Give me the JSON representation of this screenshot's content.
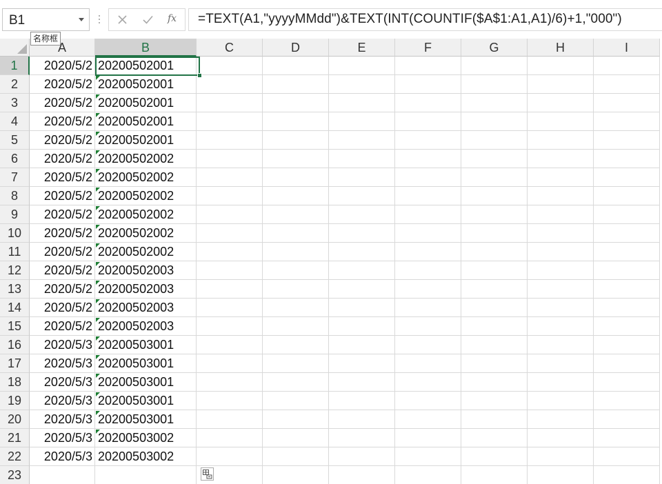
{
  "name_box": {
    "value": "B1",
    "tooltip": "名称框"
  },
  "formula_bar": {
    "cancel_icon": "close-icon",
    "enter_icon": "check-icon",
    "fx_label": "fx",
    "formula": "=TEXT(A1,\"yyyyMMdd\")&TEXT(INT(COUNTIF($A$1:A1,A1)/6)+1,\"000\")"
  },
  "columns": [
    "A",
    "B",
    "C",
    "D",
    "E",
    "F",
    "G",
    "H",
    "I"
  ],
  "active_column": "B",
  "active_row": "1",
  "active_cell": "B1",
  "rows": [
    {
      "row": "1",
      "a": "2020/5/2",
      "b": "20200502001"
    },
    {
      "row": "2",
      "a": "2020/5/2",
      "b": "20200502001"
    },
    {
      "row": "3",
      "a": "2020/5/2",
      "b": "20200502001"
    },
    {
      "row": "4",
      "a": "2020/5/2",
      "b": "20200502001"
    },
    {
      "row": "5",
      "a": "2020/5/2",
      "b": "20200502001"
    },
    {
      "row": "6",
      "a": "2020/5/2",
      "b": "20200502002"
    },
    {
      "row": "7",
      "a": "2020/5/2",
      "b": "20200502002"
    },
    {
      "row": "8",
      "a": "2020/5/2",
      "b": "20200502002"
    },
    {
      "row": "9",
      "a": "2020/5/2",
      "b": "20200502002"
    },
    {
      "row": "10",
      "a": "2020/5/2",
      "b": "20200502002"
    },
    {
      "row": "11",
      "a": "2020/5/2",
      "b": "20200502002"
    },
    {
      "row": "12",
      "a": "2020/5/2",
      "b": "20200502003"
    },
    {
      "row": "13",
      "a": "2020/5/2",
      "b": "20200502003"
    },
    {
      "row": "14",
      "a": "2020/5/2",
      "b": "20200502003"
    },
    {
      "row": "15",
      "a": "2020/5/2",
      "b": "20200502003"
    },
    {
      "row": "16",
      "a": "2020/5/3",
      "b": "20200503001"
    },
    {
      "row": "17",
      "a": "2020/5/3",
      "b": "20200503001"
    },
    {
      "row": "18",
      "a": "2020/5/3",
      "b": "20200503001"
    },
    {
      "row": "19",
      "a": "2020/5/3",
      "b": "20200503001"
    },
    {
      "row": "20",
      "a": "2020/5/3",
      "b": "20200503001"
    },
    {
      "row": "21",
      "a": "2020/5/3",
      "b": "20200503002"
    },
    {
      "row": "22",
      "a": "2020/5/3",
      "b": "20200503002"
    },
    {
      "row": "23",
      "a": "",
      "b": ""
    }
  ],
  "error_indicator_rows": [
    "2",
    "3",
    "4",
    "5",
    "6",
    "7",
    "8",
    "9",
    "10",
    "11",
    "12",
    "13",
    "14",
    "15",
    "16",
    "17",
    "18",
    "19",
    "20",
    "21"
  ],
  "colors": {
    "accent": "#217346",
    "error_indicator": "#1e7e34",
    "header_bg": "#f0f0f0",
    "active_header_bg": "#d2d2d2"
  }
}
